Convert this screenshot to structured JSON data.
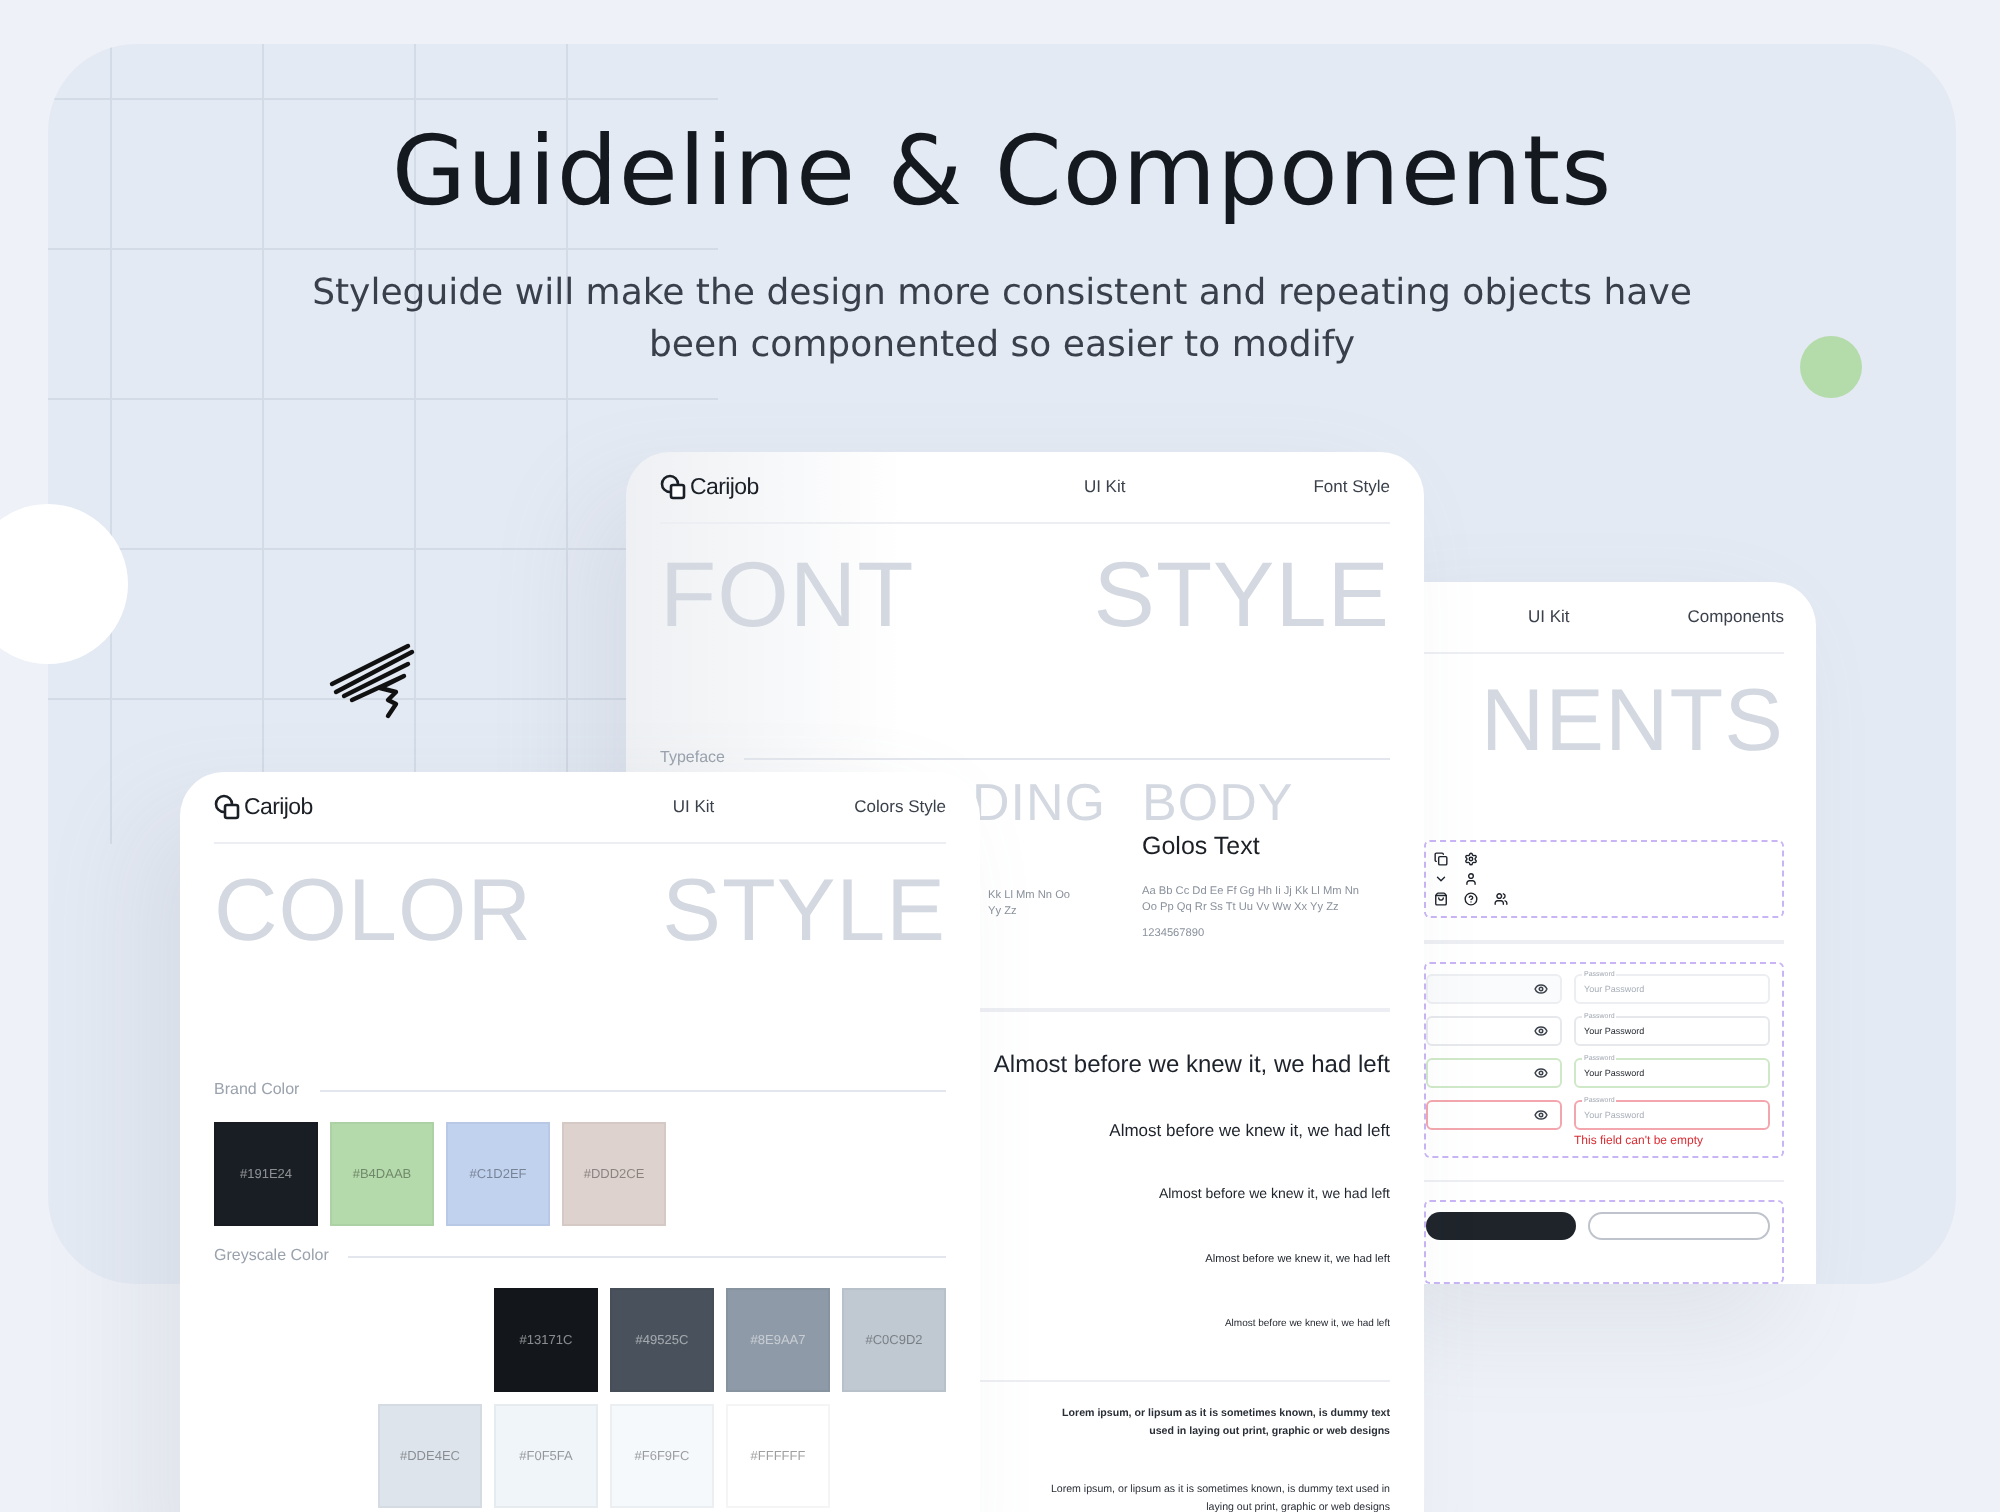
{
  "hero": {
    "title": "Guideline & Components",
    "subtitle": "Styleguide will make the design more consistent and repeating objects have been componented so easier to modify"
  },
  "component_card": {
    "nav": [
      "UI Kit",
      "Components"
    ],
    "ghost_word": "NENTS",
    "password_fields": [
      {
        "label": "Password",
        "placeholder": "Your Password",
        "kind": "default"
      },
      {
        "label": "Password",
        "value": "Your Password",
        "kind": "filled"
      },
      {
        "label": "Password",
        "value": "Your Password",
        "kind": "success"
      },
      {
        "label": "Password",
        "placeholder": "Your Password",
        "kind": "error",
        "error": "This field can't be empty"
      }
    ]
  },
  "font_card": {
    "brand": "Carijob",
    "nav": [
      "UI Kit",
      "Font Style"
    ],
    "ghost_words": [
      "FONT",
      "STYLE"
    ],
    "typeface_label": "Typeface",
    "heading_column": {
      "ghost": "DING",
      "alphabet": [
        "Kk Ll Mm Nn Oo",
        "Yy Zz"
      ]
    },
    "body_column": {
      "ghost": "BODY",
      "font_name": "Golos Text",
      "alphabet": [
        "Aa Bb Cc Dd Ee Ff Gg Hh Ii Jj Kk Ll Mm Nn",
        "Oo Pp Qq Rr Ss Tt Uu Vv Ww Xx Yy Zz"
      ],
      "digits": "1234567890"
    },
    "samples": [
      "Almost before we knew it, we had left",
      "Almost before we knew it, we had left",
      "Almost before we knew it, we had left",
      "Almost before we knew it, we had left",
      "Almost before we knew it, we had left"
    ],
    "paragraphs": [
      {
        "text": "Lorem ipsum, or lipsum as it is sometimes known, is dummy text used in laying out print, graphic or web designs",
        "kind": "bold"
      },
      {
        "text": "Lorem ipsum, or lipsum as it is sometimes known, is dummy text used in laying out print, graphic or web designs",
        "kind": "regular"
      }
    ]
  },
  "color_card": {
    "brand": "Carijob",
    "nav": [
      "UI Kit",
      "Colors Style"
    ],
    "ghost_words": [
      "COLOR",
      "STYLE"
    ],
    "brand_colors": {
      "label": "Brand Color",
      "swatches": [
        {
          "label": "#191E24",
          "color": "#191e24"
        },
        {
          "label": "#B4DAAB",
          "color": "#b4daab"
        },
        {
          "label": "#C1D2EF",
          "color": "#c1d2ef"
        },
        {
          "label": "#DDD2CE",
          "color": "#ddd2ce"
        }
      ]
    },
    "greyscale": {
      "label": "Greyscale Color",
      "rows": [
        [
          "",
          {
            "label": "#13171C",
            "color": "#13171c"
          },
          {
            "label": "#49525C",
            "color": "#49525c"
          },
          {
            "label": "#8E9AA7",
            "color": "#8e9aa7"
          },
          {
            "label": "#C0C9D2",
            "color": "#c0c9d2"
          }
        ],
        [
          {
            "label": "#DDE4EC",
            "color": "#dde4ec"
          },
          {
            "label": "#F0F5FA",
            "color": "#f0f5fa"
          },
          {
            "label": "#F6F9FC",
            "color": "#f6f9fc"
          },
          {
            "label": "#FFFFFF",
            "color": "#ffffff"
          }
        ]
      ]
    }
  }
}
